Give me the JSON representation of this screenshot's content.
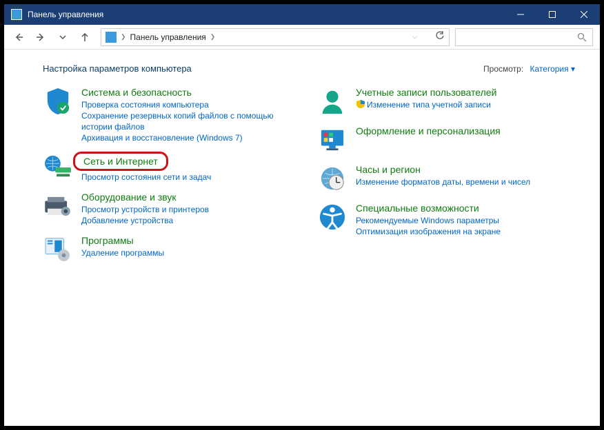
{
  "window": {
    "title": "Панель управления"
  },
  "breadcrumb": {
    "root": "Панель управления"
  },
  "header": {
    "heading": "Настройка параметров компьютера",
    "view_label": "Просмотр:",
    "view_value": "Категория"
  },
  "left": [
    {
      "title": "Система и безопасность",
      "links": [
        "Проверка состояния компьютера",
        "Сохранение резервных копий файлов с помощью истории файлов",
        "Архивация и восстановление (Windows 7)"
      ]
    },
    {
      "title": "Сеть и Интернет",
      "links": [
        "Просмотр состояния сети и задач"
      ]
    },
    {
      "title": "Оборудование и звук",
      "links": [
        "Просмотр устройств и принтеров",
        "Добавление устройства"
      ]
    },
    {
      "title": "Программы",
      "links": [
        "Удаление программы"
      ]
    }
  ],
  "right": [
    {
      "title": "Учетные записи пользователей",
      "links": [
        "Изменение типа учетной записи"
      ]
    },
    {
      "title": "Оформление и персонализация",
      "links": []
    },
    {
      "title": "Часы и регион",
      "links": [
        "Изменение форматов даты, времени и чисел"
      ]
    },
    {
      "title": "Специальные возможности",
      "links": [
        "Рекомендуемые Windows параметры",
        "Оптимизация изображения на экране"
      ]
    }
  ]
}
